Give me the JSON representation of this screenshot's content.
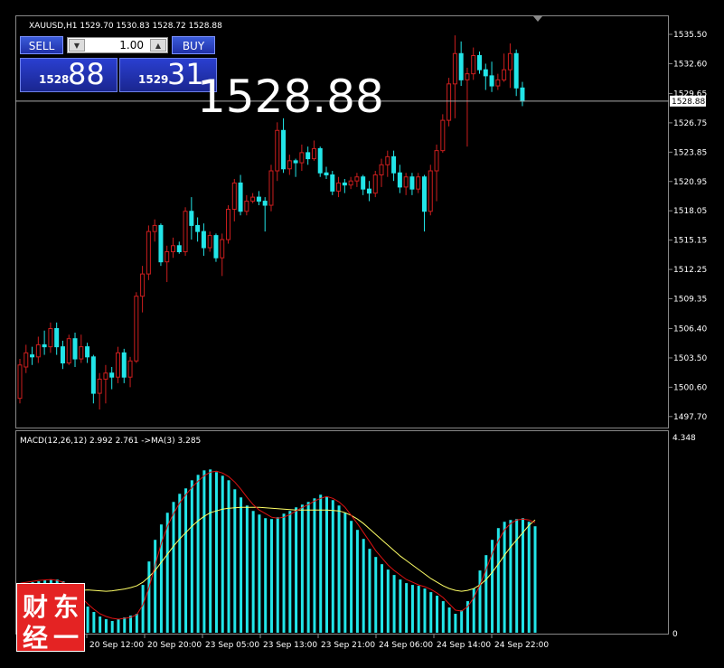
{
  "symbol_header": "XAUUSD,H1  1529.70 1530.83 1528.72 1528.88",
  "trade_panel": {
    "sell_label": "SELL",
    "buy_label": "BUY",
    "lot_value": "1.00",
    "bid_small": "1528",
    "bid_large": "88",
    "ask_small": "1529",
    "ask_large": "31"
  },
  "big_price": "1528.88",
  "current_price_label": "1528.88",
  "macd_header": "MACD(12,26,12) 2.992 2.761  ->MA(3) 3.285",
  "logo": {
    "chars": [
      "财",
      "东",
      "经",
      "一"
    ]
  },
  "colors": {
    "bull": "#cc1e1e",
    "bear": "#22e5e8",
    "macd_hist": "#22e5e8",
    "signal": "#ffff66",
    "ma": "#dd1111",
    "grid": "#888888"
  },
  "chart_data": [
    {
      "type": "candlestick",
      "ylim": [
        1496.7,
        1537.2
      ],
      "yticks": [
        "1535.50",
        "1532.60",
        "1529.65",
        "1526.75",
        "1523.85",
        "1520.95",
        "1518.05",
        "1515.15",
        "1512.25",
        "1509.35",
        "1506.40",
        "1503.50",
        "1500.60",
        "1497.70"
      ],
      "xtick_labels": [
        "20 Sep 12:00",
        "20 Sep 20:00",
        "23 Sep 05:00",
        "23 Sep 13:00",
        "23 Sep 21:00",
        "24 Sep 06:00",
        "24 Sep 14:00",
        "24 Sep 22:00"
      ],
      "candles": [
        [
          1499.5,
          1502.8,
          1499.0,
          1503.4
        ],
        [
          1502.6,
          1504.0,
          1502.0,
          1504.8
        ],
        [
          1503.8,
          1503.6,
          1502.8,
          1504.6
        ],
        [
          1503.6,
          1504.8,
          1503.0,
          1505.6
        ],
        [
          1504.8,
          1504.6,
          1503.8,
          1506.2
        ],
        [
          1504.6,
          1506.4,
          1504.0,
          1507.0
        ],
        [
          1506.4,
          1504.6,
          1503.8,
          1507.0
        ],
        [
          1504.6,
          1503.0,
          1502.4,
          1505.2
        ],
        [
          1503.0,
          1505.4,
          1502.8,
          1505.8
        ],
        [
          1505.4,
          1503.4,
          1502.6,
          1506.0
        ],
        [
          1503.4,
          1504.6,
          1503.0,
          1505.8
        ],
        [
          1504.6,
          1503.6,
          1503.0,
          1505.0
        ],
        [
          1503.6,
          1500.0,
          1499.0,
          1503.8
        ],
        [
          1500.0,
          1501.4,
          1498.4,
          1502.0
        ],
        [
          1501.4,
          1502.0,
          1499.0,
          1502.8
        ],
        [
          1502.0,
          1501.6,
          1500.4,
          1502.6
        ],
        [
          1501.6,
          1504.0,
          1501.0,
          1504.6
        ],
        [
          1504.0,
          1501.6,
          1501.0,
          1504.4
        ],
        [
          1501.6,
          1503.2,
          1500.6,
          1503.6
        ],
        [
          1503.2,
          1509.6,
          1503.0,
          1510.0
        ],
        [
          1509.6,
          1511.8,
          1508.0,
          1512.6
        ],
        [
          1511.8,
          1516.0,
          1511.2,
          1516.6
        ],
        [
          1516.0,
          1516.6,
          1515.0,
          1517.2
        ],
        [
          1516.6,
          1513.0,
          1512.6,
          1516.8
        ],
        [
          1513.0,
          1514.0,
          1511.0,
          1514.6
        ],
        [
          1514.0,
          1514.6,
          1513.4,
          1515.4
        ],
        [
          1514.6,
          1514.0,
          1513.8,
          1515.0
        ],
        [
          1514.0,
          1518.0,
          1513.6,
          1518.4
        ],
        [
          1518.0,
          1516.6,
          1515.2,
          1519.4
        ],
        [
          1516.6,
          1516.0,
          1515.0,
          1517.4
        ],
        [
          1516.0,
          1514.4,
          1513.6,
          1516.8
        ],
        [
          1514.4,
          1515.6,
          1514.0,
          1516.0
        ],
        [
          1515.6,
          1513.4,
          1513.0,
          1515.8
        ],
        [
          1513.4,
          1515.2,
          1511.6,
          1515.8
        ],
        [
          1515.2,
          1518.2,
          1514.8,
          1518.6
        ],
        [
          1518.2,
          1520.8,
          1517.0,
          1521.2
        ],
        [
          1520.8,
          1518.0,
          1517.6,
          1521.6
        ],
        [
          1518.0,
          1519.0,
          1517.6,
          1519.6
        ],
        [
          1519.0,
          1519.4,
          1518.8,
          1519.8
        ],
        [
          1519.4,
          1519.0,
          1518.6,
          1520.0
        ],
        [
          1519.0,
          1518.6,
          1516.0,
          1519.4
        ],
        [
          1518.6,
          1522.0,
          1518.0,
          1522.6
        ],
        [
          1522.0,
          1526.0,
          1521.0,
          1526.8
        ],
        [
          1526.0,
          1522.2,
          1521.8,
          1527.2
        ],
        [
          1522.2,
          1523.0,
          1521.6,
          1523.6
        ],
        [
          1523.0,
          1522.8,
          1521.4,
          1523.2
        ],
        [
          1522.8,
          1523.8,
          1522.0,
          1524.6
        ],
        [
          1523.8,
          1523.2,
          1522.6,
          1524.4
        ],
        [
          1523.2,
          1524.2,
          1523.0,
          1525.0
        ],
        [
          1524.2,
          1521.8,
          1521.4,
          1524.4
        ],
        [
          1521.8,
          1521.6,
          1521.2,
          1522.4
        ],
        [
          1521.6,
          1520.0,
          1519.6,
          1522.0
        ],
        [
          1520.0,
          1520.8,
          1519.4,
          1521.4
        ],
        [
          1520.8,
          1520.6,
          1519.8,
          1521.2
        ],
        [
          1520.6,
          1521.0,
          1520.2,
          1521.4
        ],
        [
          1521.0,
          1521.4,
          1520.4,
          1521.8
        ],
        [
          1521.4,
          1520.2,
          1519.6,
          1521.6
        ],
        [
          1520.2,
          1519.8,
          1519.0,
          1521.0
        ],
        [
          1519.8,
          1521.6,
          1519.4,
          1522.0
        ],
        [
          1521.6,
          1522.6,
          1520.4,
          1523.2
        ],
        [
          1522.6,
          1523.4,
          1521.4,
          1524.0
        ],
        [
          1523.4,
          1521.8,
          1521.0,
          1524.0
        ],
        [
          1521.8,
          1520.4,
          1519.8,
          1522.6
        ],
        [
          1520.4,
          1521.4,
          1519.6,
          1521.8
        ],
        [
          1521.4,
          1520.2,
          1519.6,
          1521.8
        ],
        [
          1520.2,
          1521.4,
          1519.8,
          1521.8
        ],
        [
          1521.4,
          1518.0,
          1516.0,
          1521.6
        ],
        [
          1518.0,
          1522.0,
          1517.6,
          1522.6
        ],
        [
          1522.0,
          1524.0,
          1519.0,
          1524.6
        ],
        [
          1524.0,
          1527.0,
          1523.8,
          1527.6
        ],
        [
          1527.0,
          1530.6,
          1526.4,
          1531.2
        ],
        [
          1530.6,
          1533.6,
          1527.2,
          1535.4
        ],
        [
          1533.6,
          1531.0,
          1530.4,
          1534.8
        ],
        [
          1531.0,
          1531.6,
          1524.4,
          1532.2
        ],
        [
          1531.6,
          1533.4,
          1531.0,
          1534.2
        ],
        [
          1533.4,
          1532.0,
          1531.6,
          1533.8
        ],
        [
          1532.0,
          1531.4,
          1530.0,
          1532.6
        ],
        [
          1531.4,
          1530.4,
          1529.8,
          1532.8
        ],
        [
          1530.4,
          1531.0,
          1530.0,
          1531.6
        ],
        [
          1531.0,
          1532.0,
          1530.8,
          1533.6
        ],
        [
          1532.0,
          1533.6,
          1530.2,
          1534.6
        ],
        [
          1533.6,
          1530.2,
          1529.4,
          1534.0
        ],
        [
          1530.2,
          1528.9,
          1528.4,
          1530.8
        ]
      ]
    },
    {
      "type": "bar",
      "title": "MACD(12,26,12) 2.992 2.761  ->MA(3) 3.285",
      "ylim": [
        0,
        4.348
      ],
      "yticks": [
        "4.348",
        "0"
      ],
      "values": [
        0.97,
        1.05,
        1.12,
        1.14,
        1.16,
        1.18,
        1.18,
        1.14,
        1.06,
        0.92,
        0.74,
        0.58,
        0.46,
        0.36,
        0.3,
        0.26,
        0.3,
        0.34,
        0.38,
        0.42,
        1.06,
        1.58,
        2.06,
        2.4,
        2.66,
        2.9,
        3.08,
        3.2,
        3.38,
        3.5,
        3.6,
        3.62,
        3.56,
        3.48,
        3.38,
        3.18,
        3.0,
        2.82,
        2.7,
        2.62,
        2.54,
        2.52,
        2.56,
        2.64,
        2.7,
        2.78,
        2.84,
        2.9,
        2.98,
        3.06,
        3.02,
        2.94,
        2.82,
        2.66,
        2.48,
        2.28,
        2.08,
        1.86,
        1.68,
        1.52,
        1.4,
        1.28,
        1.18,
        1.1,
        1.06,
        1.04,
        0.98,
        0.9,
        0.82,
        0.7,
        0.56,
        0.42,
        0.5,
        0.7,
        0.98,
        1.38,
        1.72,
        2.06,
        2.32,
        2.46,
        2.5,
        2.52,
        2.54,
        2.46,
        2.36
      ],
      "signal": [
        0.6,
        0.64,
        0.68,
        0.72,
        0.76,
        0.8,
        0.84,
        0.88,
        0.9,
        0.92,
        0.94,
        0.95,
        0.94,
        0.93,
        0.92,
        0.93,
        0.95,
        0.97,
        1.0,
        1.04,
        1.12,
        1.24,
        1.38,
        1.56,
        1.74,
        1.92,
        2.08,
        2.22,
        2.36,
        2.48,
        2.58,
        2.66,
        2.7,
        2.74,
        2.76,
        2.77,
        2.78,
        2.78,
        2.78,
        2.78,
        2.77,
        2.76,
        2.75,
        2.74,
        2.73,
        2.72,
        2.72,
        2.72,
        2.72,
        2.72,
        2.72,
        2.71,
        2.7,
        2.66,
        2.6,
        2.52,
        2.42,
        2.3,
        2.18,
        2.06,
        1.94,
        1.82,
        1.7,
        1.6,
        1.5,
        1.4,
        1.3,
        1.2,
        1.12,
        1.04,
        0.98,
        0.94,
        0.92,
        0.94,
        0.98,
        1.06,
        1.18,
        1.34,
        1.52,
        1.72,
        1.9,
        2.06,
        2.22,
        2.38,
        2.5
      ],
      "ma": [
        1.1,
        1.12,
        1.14,
        1.16,
        1.17,
        1.18,
        1.16,
        1.12,
        1.04,
        0.92,
        0.78,
        0.64,
        0.52,
        0.42,
        0.36,
        0.32,
        0.3,
        0.32,
        0.34,
        0.4,
        0.62,
        1.0,
        1.5,
        1.98,
        2.36,
        2.64,
        2.88,
        3.06,
        3.22,
        3.36,
        3.48,
        3.56,
        3.58,
        3.54,
        3.46,
        3.34,
        3.18,
        3.0,
        2.84,
        2.72,
        2.64,
        2.56,
        2.54,
        2.56,
        2.62,
        2.7,
        2.78,
        2.84,
        2.92,
        2.98,
        3.02,
        2.98,
        2.9,
        2.78,
        2.6,
        2.42,
        2.22,
        2.02,
        1.82,
        1.66,
        1.5,
        1.38,
        1.28,
        1.18,
        1.12,
        1.06,
        1.02,
        0.96,
        0.88,
        0.78,
        0.64,
        0.5,
        0.48,
        0.58,
        0.78,
        1.06,
        1.4,
        1.76,
        2.04,
        2.28,
        2.42,
        2.5,
        2.52,
        2.5,
        2.44
      ]
    }
  ]
}
